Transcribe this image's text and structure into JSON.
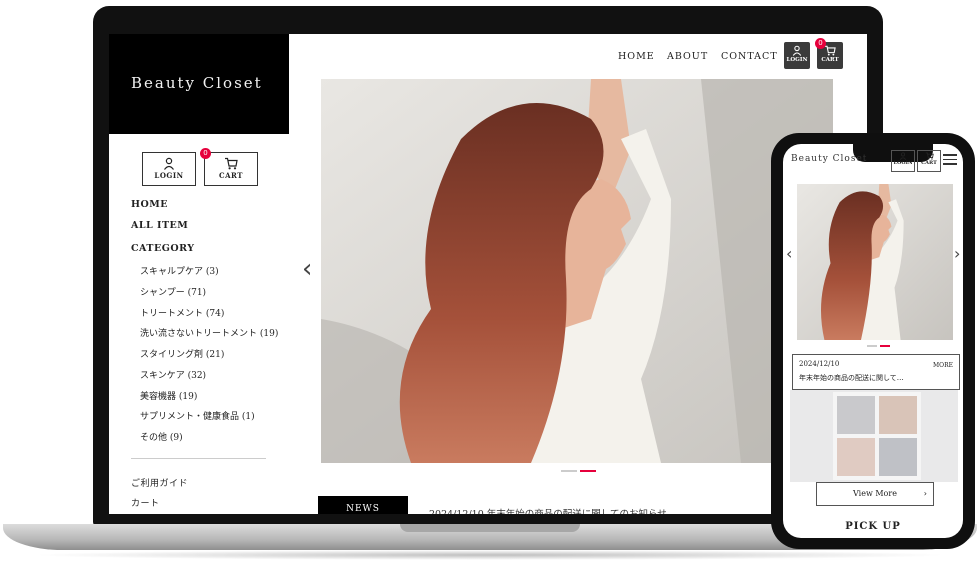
{
  "brand": {
    "name": "Beauty Closet"
  },
  "header": {
    "nav": [
      "HOME",
      "ABOUT",
      "CONTACT"
    ],
    "login_label": "LOGIN",
    "cart_label": "CART",
    "cart_count": "0"
  },
  "sidebar": {
    "login_label": "LOGIN",
    "cart_label": "CART",
    "cart_count": "0",
    "main_links": [
      "HOME",
      "ALL ITEM"
    ],
    "category_heading": "CATEGORY",
    "categories": [
      "スキャルプケア (3)",
      "シャンプー (71)",
      "トリートメント (74)",
      "洗い流さないトリートメント (19)",
      "スタイリング剤 (21)",
      "スキンケア (32)",
      "美容機器 (19)",
      "サプリメント・健康食品 (1)",
      "その他 (9)"
    ],
    "footer_links": [
      "ご利用ガイド",
      "カート"
    ]
  },
  "hero": {
    "prev_arrow": "‹",
    "next_arrow": "›",
    "slide_count": 2,
    "active_slide": 2
  },
  "news": {
    "label": "NEWS",
    "text": "2024/12/10 年末年始の商品の配送に関してのお知らせ"
  },
  "mobile": {
    "brand": "Beauty Closet",
    "login_label": "LOGIN",
    "cart_label": "CART",
    "news_date": "2024/12/10",
    "news_title": "年末年始の商品の配送に関して…",
    "news_more": "MORE",
    "view_more": "View More",
    "pickup_heading": "PICK UP"
  },
  "colors": {
    "accent": "#e6003c",
    "dark": "#000000",
    "hair": "#8a3f2c"
  }
}
